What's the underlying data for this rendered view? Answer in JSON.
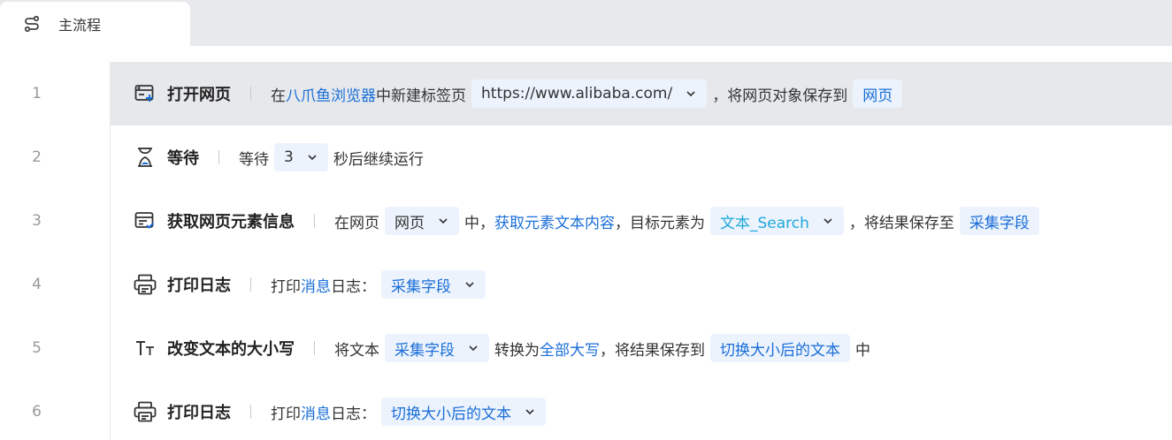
{
  "tab": {
    "label": "主流程",
    "icon": "flow-icon"
  },
  "rows": [
    {
      "line": "1",
      "icon": "open-webpage-icon",
      "title": "打开网页",
      "p1": "在",
      "browser": "八爪鱼浏览器",
      "p2": "中新建标签页",
      "url": "https://www.alibaba.com/",
      "p3": "，将网页对象保存到",
      "var": "网页"
    },
    {
      "line": "2",
      "icon": "hourglass-icon",
      "title": "等待",
      "p1": "等待",
      "seconds": "3",
      "p2": "秒后继续运行"
    },
    {
      "line": "3",
      "icon": "webpage-info-icon",
      "title": "获取网页元素信息",
      "p1": "在网页",
      "page": "网页",
      "p2": "中，",
      "action": "获取元素文本内容",
      "p3": "，目标元素为",
      "element": "文本_Search",
      "p4": "，将结果保存至",
      "var": "采集字段"
    },
    {
      "line": "4",
      "icon": "printer-icon",
      "title": "打印日志",
      "p1": "打印",
      "level": "消息",
      "p2": "日志：",
      "value": "采集字段"
    },
    {
      "line": "5",
      "icon": "text-case-icon",
      "title": "改变文本的大小写",
      "p1": "将文本",
      "source": "采集字段",
      "p2": "转换为",
      "mode": "全部大写",
      "p3": "，将结果保存到",
      "var": "切换大小后的文本",
      "p4": "中"
    },
    {
      "line": "6",
      "icon": "printer-icon",
      "title": "打印日志",
      "p1": "打印",
      "level": "消息",
      "p2": "日志：",
      "value": "切换大小后的文本"
    }
  ],
  "colors": {
    "link": "#1a6ed8",
    "chip_bg": "#ecf3fd",
    "selected_row": "#e6e8eb",
    "element_cyan": "#1fa8d8"
  }
}
